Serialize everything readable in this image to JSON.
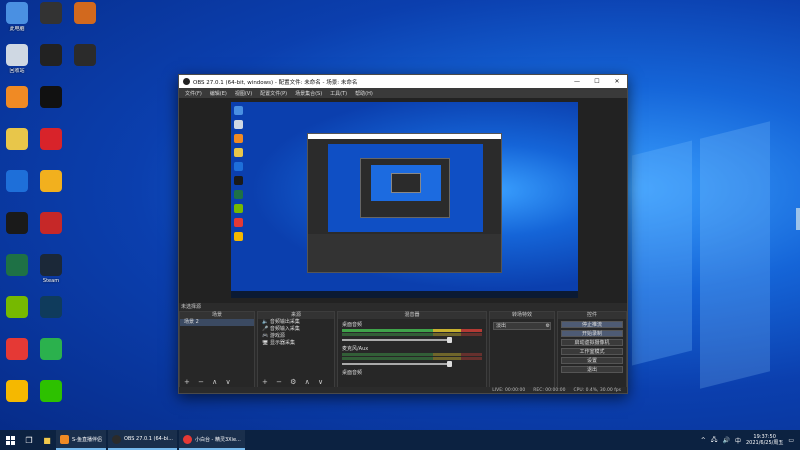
{
  "desktop": {
    "icons": [
      {
        "label": "此电脑",
        "icon": "computer-icon",
        "color": "#4a90e2"
      },
      {
        "label": "",
        "icon": "app-icon",
        "color": "#333333"
      },
      {
        "label": "",
        "icon": "basketball-icon",
        "color": "#d2691e"
      },
      {
        "label": "回收站",
        "icon": "recycle-bin-icon",
        "color": "#cfd8e3"
      },
      {
        "label": "",
        "icon": "pen-icon",
        "color": "#222222"
      },
      {
        "label": "",
        "icon": "obs-icon",
        "color": "#2b2b2b"
      },
      {
        "label": "",
        "icon": "app-icon",
        "color": "#f08a24"
      },
      {
        "label": "",
        "icon": "game-icon",
        "color": "#111111"
      },
      {
        "label": "",
        "icon": "file-icon",
        "color": "#e8c64a"
      },
      {
        "label": "",
        "icon": "music-icon",
        "color": "#d8232a"
      },
      {
        "label": "",
        "icon": "k-icon",
        "color": "#1e6fd9"
      },
      {
        "label": "",
        "icon": "go-icon",
        "color": "#f2b01e"
      },
      {
        "label": "",
        "icon": "app-icon",
        "color": "#1a1a1a"
      },
      {
        "label": "",
        "icon": "app-icon",
        "color": "#c62828"
      },
      {
        "label": "",
        "icon": "excel-icon",
        "color": "#1e7145"
      },
      {
        "label": "Steam",
        "icon": "steam-icon",
        "color": "#1b2838"
      },
      {
        "label": "",
        "icon": "nvidia-icon",
        "color": "#76b900"
      },
      {
        "label": "",
        "icon": "app-icon",
        "color": "#0f3b5c"
      },
      {
        "label": "",
        "icon": "app-icon",
        "color": "#e53935"
      },
      {
        "label": "",
        "icon": "video-icon",
        "color": "#2bb14d"
      },
      {
        "label": "",
        "icon": "app-icon",
        "color": "#f5b800"
      },
      {
        "label": "",
        "icon": "wechat-icon",
        "color": "#2dc100"
      }
    ]
  },
  "obs": {
    "title": "OBS 27.0.1 (64-bit, windows) - 配置文件: 未命名 - 场景: 未命名",
    "menu": [
      "文件(F)",
      "编辑(E)",
      "视图(V)",
      "配置文件(P)",
      "场景集合(S)",
      "工具(T)",
      "帮助(H)"
    ],
    "dock_header": "未选择源",
    "scenes": {
      "header": "场景",
      "items": [
        "场景 2"
      ],
      "footer": "+ − ∧ ∨"
    },
    "sources": {
      "header": "来源",
      "items": [
        "音频输出采集",
        "音频输入采集",
        "游戏源",
        "显示器采集"
      ],
      "footer": "+ − ⚙ ∧ ∨"
    },
    "mixer": {
      "header": "混音器",
      "channels": [
        "桌面音频",
        "麦克风/Aux",
        "桌面音频"
      ]
    },
    "transitions": {
      "header": "转场特效",
      "value": "淡出"
    },
    "controls": {
      "header": "控件",
      "buttons": [
        "停止推流",
        "开始录制",
        "启动虚拟摄像机",
        "工作室模式",
        "设置",
        "退出"
      ]
    },
    "status": [
      "LIVE: 00:00:00",
      "REC: 00:00:00",
      "CPU: 0.4%, 30.00 fps"
    ]
  },
  "taskbar": {
    "apps": [
      {
        "label": "S-鱼直播伴侣",
        "color": "#f08a24"
      },
      {
        "label": "OBS 27.0.1 (64-bi...",
        "color": "#2b2b2b"
      },
      {
        "label": "小白台 - 精灵3Xie...",
        "color": "#e53935"
      }
    ],
    "tray": [
      "^",
      "中"
    ],
    "time": "19:37:50",
    "date": "2021/6/25/周五"
  }
}
